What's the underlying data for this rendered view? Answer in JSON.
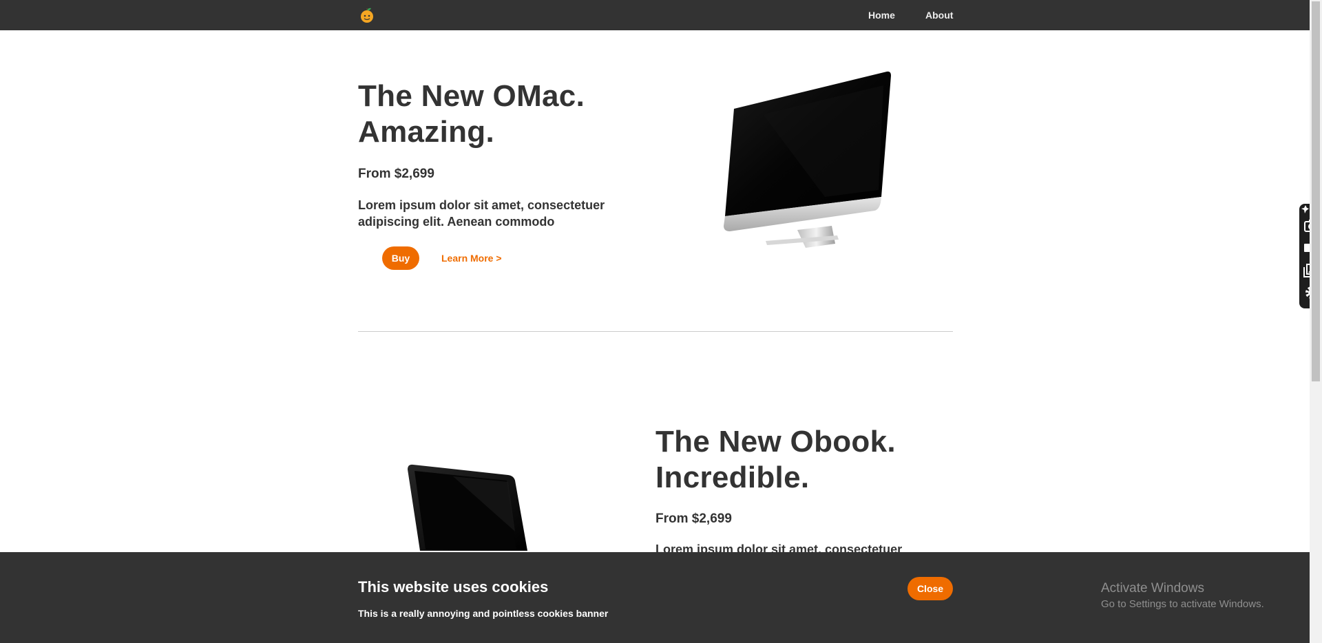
{
  "nav": {
    "logo_icon": "orange-fruit-logo",
    "links": [
      {
        "label": "Home"
      },
      {
        "label": "About"
      }
    ]
  },
  "products": [
    {
      "title_line1": "The New OMac.",
      "title_line2": "Amazing.",
      "price": "From $2,699",
      "description": "Lorem ipsum dolor sit amet, consectetuer adipiscing elit. Aenean commodo",
      "buy_label": "Buy",
      "learn_label": "Learn More >",
      "image_icon": "desktop-monitor"
    },
    {
      "title_line1": "The New Obook.",
      "title_line2": "Incredible.",
      "price": "From $2,699",
      "description": "Lorem ipsum dolor sit amet, consectetuer",
      "image_icon": "laptop"
    }
  ],
  "side_toolbar": {
    "icons": [
      "pin-icon",
      "camera-icon",
      "video-icon",
      "gallery-icon",
      "gear-icon"
    ]
  },
  "cookie_banner": {
    "title": "This website uses cookies",
    "text": "This is a really annoying and pointless cookies banner",
    "close_label": "Close"
  },
  "watermark": {
    "title": "Activate Windows",
    "subtitle": "Go to Settings to activate Windows."
  },
  "colors": {
    "accent": "#ef6c00",
    "dark": "#333333",
    "text": "#333333",
    "background": "#ffffff"
  }
}
